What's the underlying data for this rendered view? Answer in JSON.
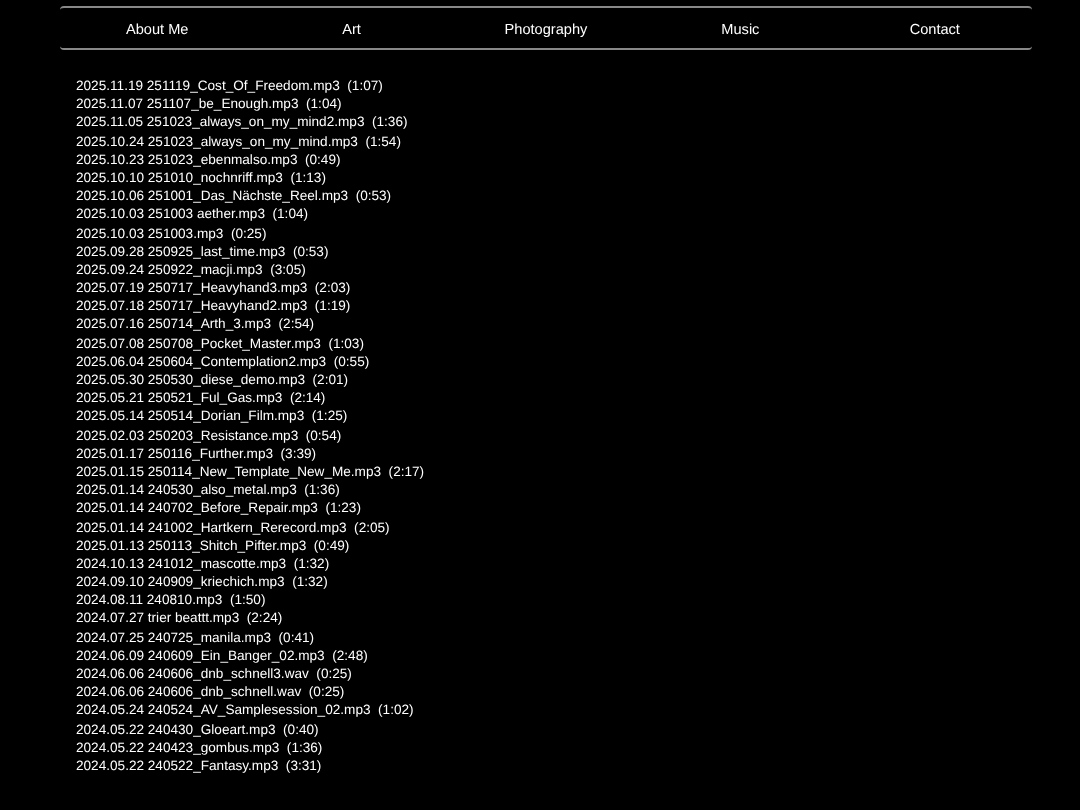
{
  "nav": [
    {
      "label": "About Me"
    },
    {
      "label": "Art"
    },
    {
      "label": "Photography"
    },
    {
      "label": "Music"
    },
    {
      "label": "Contact"
    }
  ],
  "tracks": [
    {
      "date": "2025.11.19",
      "file": "251119_Cost_Of_Freedom.mp3",
      "duration": "(1:07)"
    },
    {
      "date": "2025.11.07",
      "file": "251107_be_Enough.mp3",
      "duration": "(1:04)"
    },
    {
      "date": "2025.11.05",
      "file": "251023_always_on_my_mind2.mp3",
      "duration": "(1:36)"
    },
    {
      "date": "2025.10.24",
      "file": "251023_always_on_my_mind.mp3",
      "duration": "(1:54)"
    },
    {
      "date": "2025.10.23",
      "file": "251023_ebenmalso.mp3",
      "duration": "(0:49)"
    },
    {
      "date": "2025.10.10",
      "file": "251010_nochnriff.mp3",
      "duration": "(1:13)"
    },
    {
      "date": "2025.10.06",
      "file": "251001_Das_Nächste_Reel.mp3",
      "duration": "(0:53)"
    },
    {
      "date": "2025.10.03",
      "file": "251003 aether.mp3",
      "duration": "(1:04)"
    },
    {
      "date": "2025.10.03",
      "file": "251003.mp3",
      "duration": "(0:25)"
    },
    {
      "date": "2025.09.28",
      "file": "250925_last_time.mp3",
      "duration": "(0:53)"
    },
    {
      "date": "2025.09.24",
      "file": "250922_macji.mp3",
      "duration": "(3:05)"
    },
    {
      "date": "2025.07.19",
      "file": "250717_Heavyhand3.mp3",
      "duration": "(2:03)"
    },
    {
      "date": "2025.07.18",
      "file": "250717_Heavyhand2.mp3",
      "duration": "(1:19)"
    },
    {
      "date": "2025.07.16",
      "file": "250714_Arth_3.mp3",
      "duration": "(2:54)"
    },
    {
      "date": "2025.07.08",
      "file": "250708_Pocket_Master.mp3",
      "duration": "(1:03)"
    },
    {
      "date": "2025.06.04",
      "file": "250604_Contemplation2.mp3",
      "duration": "(0:55)"
    },
    {
      "date": "2025.05.30",
      "file": "250530_diese_demo.mp3",
      "duration": "(2:01)"
    },
    {
      "date": "2025.05.21",
      "file": "250521_Ful_Gas.mp3",
      "duration": "(2:14)"
    },
    {
      "date": "2025.05.14",
      "file": "250514_Dorian_Film.mp3",
      "duration": "(1:25)"
    },
    {
      "date": "2025.02.03",
      "file": "250203_Resistance.mp3",
      "duration": "(0:54)"
    },
    {
      "date": "2025.01.17",
      "file": "250116_Further.mp3",
      "duration": "(3:39)"
    },
    {
      "date": "2025.01.15",
      "file": "250114_New_Template_New_Me.mp3",
      "duration": "(2:17)"
    },
    {
      "date": "2025.01.14",
      "file": "240530_also_metal.mp3",
      "duration": "(1:36)"
    },
    {
      "date": "2025.01.14",
      "file": "240702_Before_Repair.mp3",
      "duration": "(1:23)"
    },
    {
      "date": "2025.01.14",
      "file": "241002_Hartkern_Rerecord.mp3",
      "duration": "(2:05)"
    },
    {
      "date": "2025.01.13",
      "file": "250113_Shitch_Pifter.mp3",
      "duration": "(0:49)"
    },
    {
      "date": "2024.10.13",
      "file": "241012_mascotte.mp3",
      "duration": "(1:32)"
    },
    {
      "date": "2024.09.10",
      "file": "240909_kriechich.mp3",
      "duration": "(1:32)"
    },
    {
      "date": "2024.08.11",
      "file": "240810.mp3",
      "duration": "(1:50)"
    },
    {
      "date": "2024.07.27",
      "file": "trier beattt.mp3",
      "duration": "(2:24)"
    },
    {
      "date": "2024.07.25",
      "file": "240725_manila.mp3",
      "duration": "(0:41)"
    },
    {
      "date": "2024.06.09",
      "file": "240609_Ein_Banger_02.mp3",
      "duration": "(2:48)"
    },
    {
      "date": "2024.06.06",
      "file": "240606_dnb_schnell3.wav",
      "duration": "(0:25)"
    },
    {
      "date": "2024.06.06",
      "file": "240606_dnb_schnell.wav",
      "duration": "(0:25)"
    },
    {
      "date": "2024.05.24",
      "file": "240524_AV_Samplesession_02.mp3",
      "duration": "(1:02)"
    },
    {
      "date": "2024.05.22",
      "file": "240430_Gloeart.mp3",
      "duration": "(0:40)"
    },
    {
      "date": "2024.05.22",
      "file": "240423_gombus.mp3",
      "duration": "(1:36)"
    },
    {
      "date": "2024.05.22",
      "file": "240522_Fantasy.mp3",
      "duration": "(3:31)"
    }
  ]
}
